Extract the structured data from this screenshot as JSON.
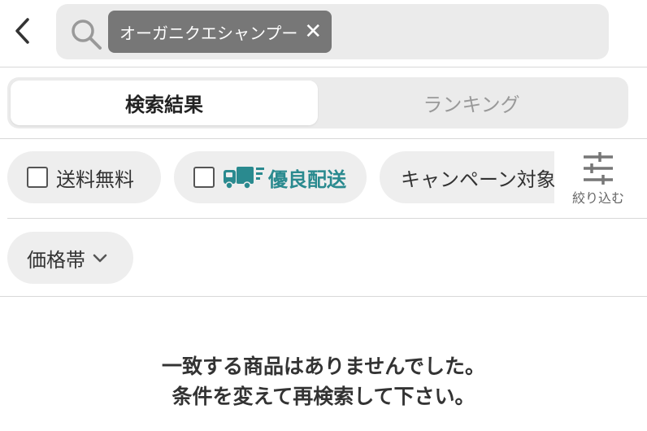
{
  "header": {
    "back_icon": "chevron-left-icon",
    "search_icon": "search-icon",
    "search_chip": {
      "label": "オーガニクエシャンプー",
      "clear_icon": "close-icon",
      "clear_glyph": "✕"
    }
  },
  "tabs": [
    {
      "label": "検索結果",
      "active": true
    },
    {
      "label": "ランキング",
      "active": false
    }
  ],
  "filters": {
    "free_shipping": {
      "label": "送料無料",
      "checked": false
    },
    "good_delivery": {
      "label": "優良配送",
      "checked": false,
      "icon": "truck-icon",
      "color": "#2a8a8f"
    },
    "campaign": {
      "label": "キャンペーン対象"
    },
    "refine": {
      "label": "絞り込む",
      "icon": "sliders-icon"
    },
    "price_range": {
      "label": "価格帯",
      "icon": "chevron-down-icon"
    }
  },
  "empty_state": {
    "line1": "一致する商品はありませんでした。",
    "line2": "条件を変えて再検索して下さい。"
  },
  "colors": {
    "chip_bg": "#777777",
    "search_bg": "#ebebeb",
    "pill_bg": "#eeeeee",
    "accent_teal": "#2a8a8f"
  }
}
